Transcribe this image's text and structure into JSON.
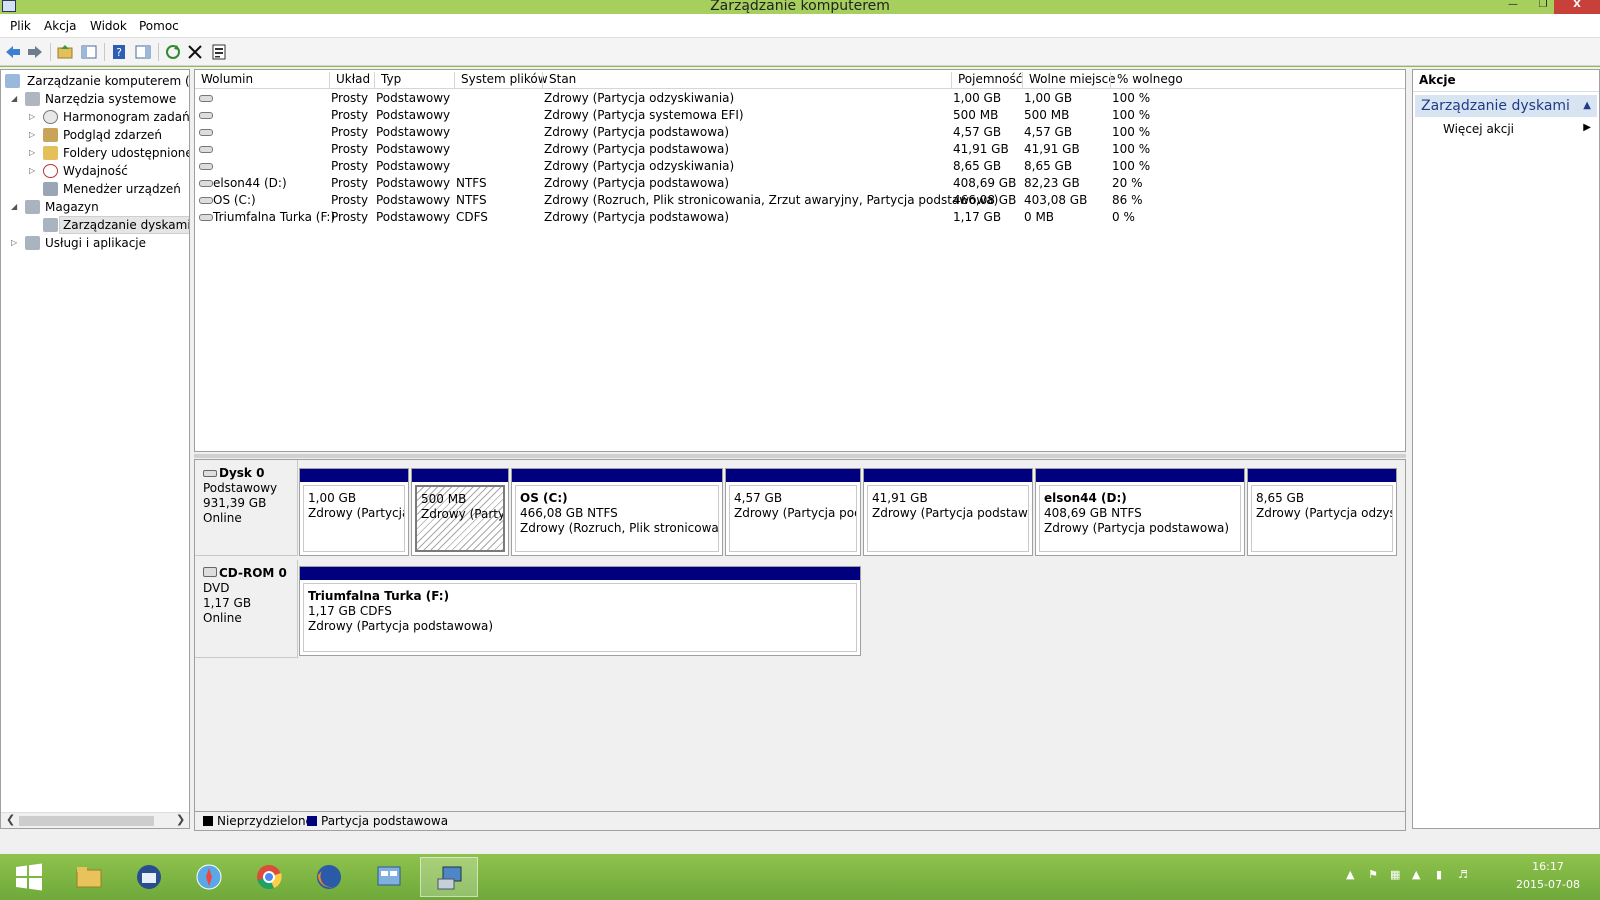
{
  "window": {
    "title": "Zarządzanie komputerem",
    "close_glyph": "X"
  },
  "menu": [
    "Plik",
    "Akcja",
    "Widok",
    "Pomoc"
  ],
  "tree": {
    "items": [
      {
        "label": "Zarządzanie komputerem (lokal"
      },
      {
        "label": "Narzędzia systemowe"
      },
      {
        "label": "Harmonogram zadań"
      },
      {
        "label": "Podgląd zdarzeń"
      },
      {
        "label": "Foldery udostępnione"
      },
      {
        "label": "Wydajność"
      },
      {
        "label": "Menedżer urządzeń"
      },
      {
        "label": "Magazyn"
      },
      {
        "label": "Zarządzanie dyskami"
      },
      {
        "label": "Usługi i aplikacje"
      }
    ]
  },
  "volumes": {
    "columns": [
      "Wolumin",
      "Układ",
      "Typ",
      "System plików",
      "Stan",
      "Pojemność",
      "Wolne miejsce",
      "% wolnego"
    ],
    "rows": [
      [
        "",
        "Prosty",
        "Podstawowy",
        "",
        "Zdrowy (Partycja odzyskiwania)",
        "1,00 GB",
        "1,00 GB",
        "100 %"
      ],
      [
        "",
        "Prosty",
        "Podstawowy",
        "",
        "Zdrowy (Partycja systemowa EFI)",
        "500 MB",
        "500 MB",
        "100 %"
      ],
      [
        "",
        "Prosty",
        "Podstawowy",
        "",
        "Zdrowy (Partycja podstawowa)",
        "4,57 GB",
        "4,57 GB",
        "100 %"
      ],
      [
        "",
        "Prosty",
        "Podstawowy",
        "",
        "Zdrowy (Partycja podstawowa)",
        "41,91 GB",
        "41,91 GB",
        "100 %"
      ],
      [
        "",
        "Prosty",
        "Podstawowy",
        "",
        "Zdrowy (Partycja odzyskiwania)",
        "8,65 GB",
        "8,65 GB",
        "100 %"
      ],
      [
        "elson44 (D:)",
        "Prosty",
        "Podstawowy",
        "NTFS",
        "Zdrowy (Partycja podstawowa)",
        "408,69 GB",
        "82,23 GB",
        "20 %"
      ],
      [
        "OS (C:)",
        "Prosty",
        "Podstawowy",
        "NTFS",
        "Zdrowy (Rozruch, Plik stronicowania, Zrzut awaryjny, Partycja podstawowa)",
        "466,08 GB",
        "403,08 GB",
        "86 %"
      ],
      [
        "Triumfalna Turka (F:)",
        "Prosty",
        "Podstawowy",
        "CDFS",
        "Zdrowy (Partycja podstawowa)",
        "1,17 GB",
        "0 MB",
        "0 %"
      ]
    ]
  },
  "disks": [
    {
      "name": "Dysk 0",
      "type": "Podstawowy",
      "size": "931,39 GB",
      "status": "Online",
      "partitions": [
        {
          "name": "",
          "size": "1,00 GB",
          "status": "Zdrowy (Partycja c"
        },
        {
          "name": "",
          "size": "500 MB",
          "status": "Zdrowy (Partycja"
        },
        {
          "name": "OS  (C:)",
          "size": "466,08 GB NTFS",
          "status": "Zdrowy (Rozruch, Plik stronicowania,"
        },
        {
          "name": "",
          "size": "4,57 GB",
          "status": "Zdrowy (Partycja podst"
        },
        {
          "name": "",
          "size": "41,91 GB",
          "status": "Zdrowy (Partycja podstawowa"
        },
        {
          "name": "elson44  (D:)",
          "size": "408,69 GB NTFS",
          "status": "Zdrowy (Partycja podstawowa)"
        },
        {
          "name": "",
          "size": "8,65 GB",
          "status": "Zdrowy (Partycja odzyskiv"
        }
      ]
    },
    {
      "name": "CD-ROM 0",
      "type": "DVD",
      "size": "1,17 GB",
      "status": "Online",
      "partitions": [
        {
          "name": "Triumfalna Turka  (F:)",
          "size": "1,17 GB CDFS",
          "status": "Zdrowy (Partycja podstawowa)"
        }
      ]
    }
  ],
  "legend": [
    {
      "label": "Nieprzydzielone",
      "color": "#000000"
    },
    {
      "label": "Partycja podstawowa",
      "color": "#00007f"
    }
  ],
  "actions": {
    "header": "Akcje",
    "section": "Zarządzanie dyskami",
    "item": "Więcej akcji"
  },
  "taskbar": {
    "apps": [
      "start-button",
      "file-explorer",
      "thunderbird",
      "safari",
      "chrome",
      "firefox",
      "control-panel",
      "computer-management"
    ],
    "clock_time": "16:17",
    "clock_date": "2015-07-08"
  },
  "colors": {
    "primary_partition": "#00007f",
    "taskbar": "#8cbf4a",
    "actions_section": "#d8e4f2"
  }
}
